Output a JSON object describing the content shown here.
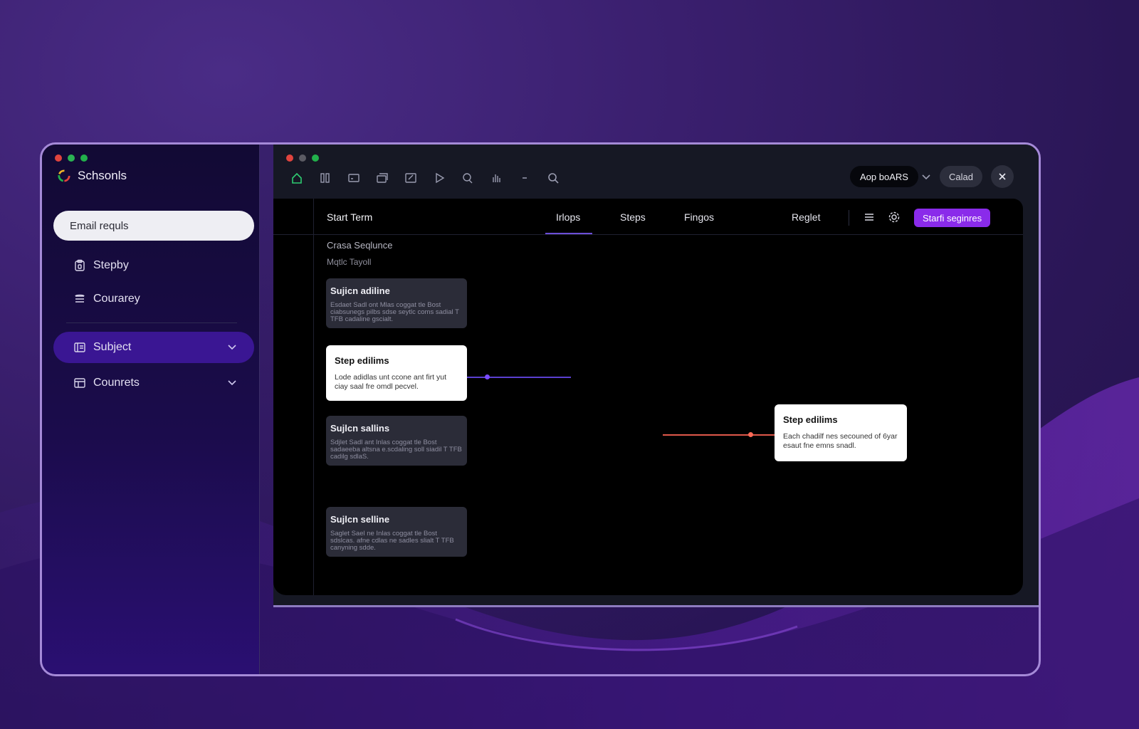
{
  "sidebar": {
    "app_name": "Schsonls",
    "email_button": "Email requls",
    "items": [
      {
        "label": "Stepby",
        "icon": "clipboard-icon"
      },
      {
        "label": "Courarey",
        "icon": "stack-icon"
      },
      {
        "label": "Subject",
        "icon": "book-icon",
        "active": true
      },
      {
        "label": "Counrets",
        "icon": "grid-icon"
      }
    ]
  },
  "window": {
    "toolbar_icons": [
      "home-icon",
      "columns-icon",
      "window-icon",
      "layers-icon",
      "edit-icon",
      "play-icon",
      "chat-icon",
      "hand-icon",
      "minus-icon",
      "search-icon"
    ],
    "pill_dark": "Aop boARS",
    "pill_gray": "Calad"
  },
  "panel": {
    "title": "Start Term",
    "tabs": [
      "Irlops",
      "Steps",
      "Fingos"
    ],
    "active_tab": "Irlops",
    "reglet": "Reglet",
    "start_button": "Starfi seginres",
    "subtitle1": "Crasa Seqlunce",
    "subtitle2": "Mqtlc Tayoll",
    "cards": [
      {
        "title": "Sujicn adiline",
        "body": "Esdaet Sadl ont Mlas coggat tle Bost ciabsunegs pilbs sdse seytlc coms sadial T TFB cadaline gscialt."
      },
      {
        "title": "Step edilims",
        "body": "Lode adidlas unt ccone ant firt yut ciay saal fre omdl pecvel."
      },
      {
        "title": "Sujlcn sallins",
        "body": "Sdjlet Sadl ant Inlas coggat tle Bost sadaeeba altsna e.scdaling soll siadil T TFB cadilg sdlaS."
      },
      {
        "title": "Sujlcn selline",
        "body": "Saglet Sael ne Inlas coggat tle Bost sdslcas. afne cdlas ne sadles slialt T TFB canyning sdde."
      },
      {
        "title": "Step edilims",
        "body": "Each chadilf nes secouned of 6yar esaut fne emns snadl."
      }
    ]
  },
  "colors": {
    "accent": "#8a2bea",
    "connector_purple": "#5b3fd0",
    "connector_red": "#e0584a"
  }
}
